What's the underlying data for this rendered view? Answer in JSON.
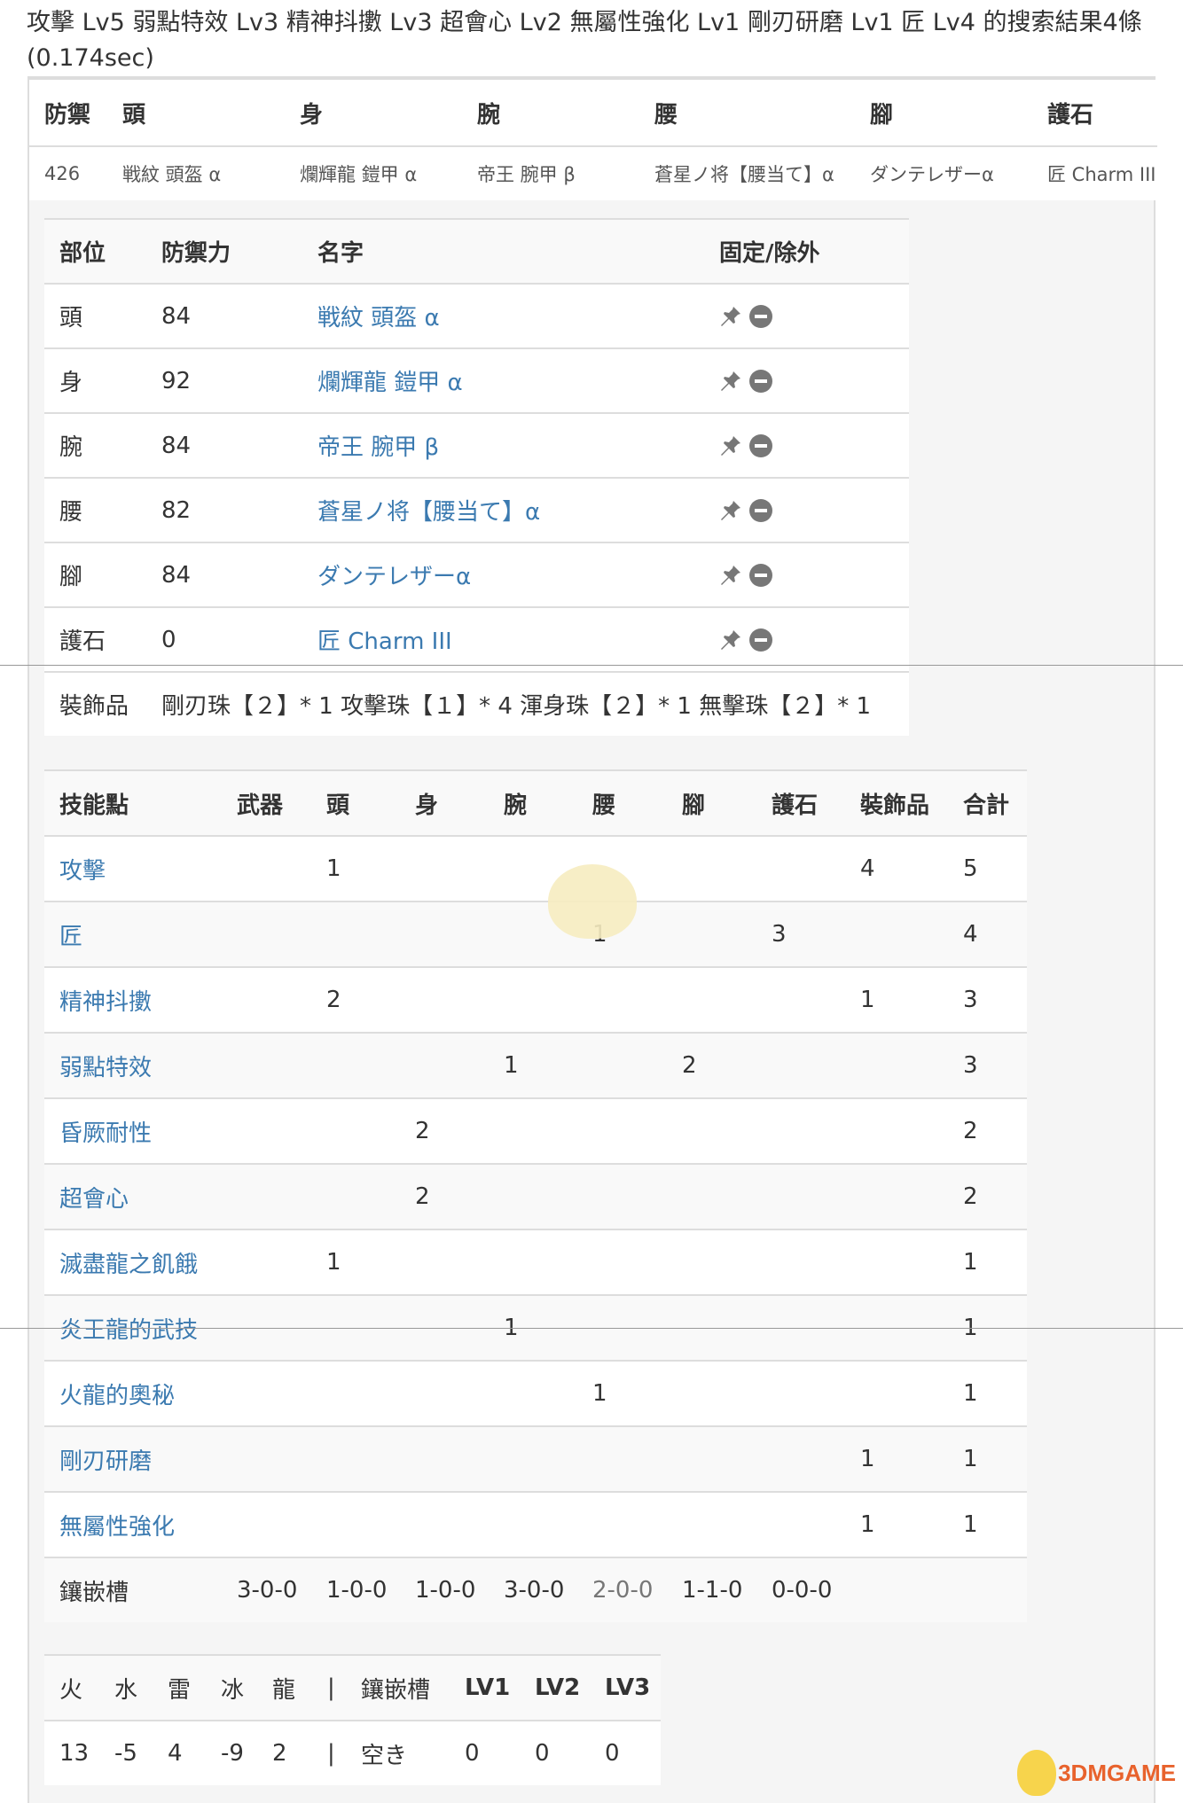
{
  "title": "攻擊 Lv5 弱點特效 Lv3 精神抖擻 Lv3 超會心 Lv2 無屬性強化 Lv1 剛刃研磨 Lv1 匠 Lv4 的搜索結果4條 (0.174sec)",
  "summary": {
    "headers": [
      "防禦",
      "頭",
      "身",
      "腕",
      "腰",
      "腳",
      "護石"
    ],
    "values": [
      "426",
      "戦紋 頭盔 α",
      "爛輝龍 鎧甲 α",
      "帝王 腕甲 β",
      "蒼星ノ将【腰当て】α",
      "ダンテレザーα",
      "匠 Charm III"
    ]
  },
  "equipment": {
    "headers": [
      "部位",
      "防禦力",
      "名字",
      "固定/除外"
    ],
    "rows": [
      {
        "part": "頭",
        "def": "84",
        "name": "戦紋 頭盔 α"
      },
      {
        "part": "身",
        "def": "92",
        "name": "爛輝龍 鎧甲 α"
      },
      {
        "part": "腕",
        "def": "84",
        "name": "帝王 腕甲 β"
      },
      {
        "part": "腰",
        "def": "82",
        "name": "蒼星ノ将【腰当て】α"
      },
      {
        "part": "腳",
        "def": "84",
        "name": "ダンテレザーα"
      },
      {
        "part": "護石",
        "def": "0",
        "name": "匠 Charm III"
      }
    ],
    "action_icons": [
      "pin-icon",
      "remove-icon"
    ],
    "decorations_label": "裝飾品",
    "decorations": "剛刃珠【２】* 1 攻擊珠【１】* 4 渾身珠【２】* 1 無擊珠【２】* 1"
  },
  "skills": {
    "headers": [
      "技能點",
      "武器",
      "頭",
      "身",
      "腕",
      "腰",
      "腳",
      "護石",
      "裝飾品",
      "合計"
    ],
    "rows": [
      [
        "攻擊",
        "",
        "1",
        "",
        "",
        "",
        "",
        "",
        "4",
        "5"
      ],
      [
        "匠",
        "",
        "",
        "",
        "",
        "1",
        "",
        "3",
        "",
        "4"
      ],
      [
        "精神抖擻",
        "",
        "2",
        "",
        "",
        "",
        "",
        "",
        "1",
        "3"
      ],
      [
        "弱點特效",
        "",
        "",
        "",
        "1",
        "",
        "2",
        "",
        "",
        "3"
      ],
      [
        "昏厥耐性",
        "",
        "",
        "2",
        "",
        "",
        "",
        "",
        "",
        "2"
      ],
      [
        "超會心",
        "",
        "",
        "2",
        "",
        "",
        "",
        "",
        "",
        "2"
      ],
      [
        "滅盡龍之飢餓",
        "",
        "1",
        "",
        "",
        "",
        "",
        "",
        "",
        "1"
      ],
      [
        "炎王龍的武技",
        "",
        "",
        "",
        "1",
        "",
        "",
        "",
        "",
        "1"
      ],
      [
        "火龍的奧秘",
        "",
        "",
        "",
        "",
        "1",
        "",
        "",
        "",
        "1"
      ],
      [
        "剛刃研磨",
        "",
        "",
        "",
        "",
        "",
        "",
        "",
        "1",
        "1"
      ],
      [
        "無屬性強化",
        "",
        "",
        "",
        "",
        "",
        "",
        "",
        "1",
        "1"
      ]
    ],
    "slots": [
      "鑲嵌槽",
      "3-0-0",
      "1-0-0",
      "1-0-0",
      "3-0-0",
      "2-0-0",
      "1-1-0",
      "0-0-0"
    ]
  },
  "elements": {
    "headers": [
      "火",
      "水",
      "雷",
      "冰",
      "龍",
      "|",
      "鑲嵌槽",
      "LV1",
      "LV2",
      "LV3"
    ],
    "values": [
      "13",
      "-5",
      "4",
      "-9",
      "2",
      "|",
      "空き",
      "0",
      "0",
      "0"
    ]
  },
  "watermark": "3DMGAME",
  "colors": {
    "link": "#3b7ab0",
    "header_bg": "#f9f9f9",
    "panel_bg": "#f5f5f5",
    "border": "#dddddd"
  }
}
